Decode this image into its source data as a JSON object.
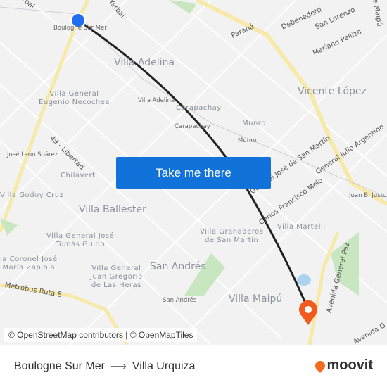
{
  "map": {
    "labels": {
      "boulogne_station": "Boulogne Sur Mer",
      "yerbal": "Yerbal",
      "rbal": "rbal",
      "villa_adelina": "Villa Adelina",
      "villa_adelina_st": "Villa Adelina",
      "necochea": "Villa General\nEugenio Necochea",
      "libertad": "49 - Libertad",
      "jose_leon": "José León Suárez",
      "chilavert": "Chilavert",
      "godoy": "Villa Godoy Cruz",
      "ballester": "Villa Ballester",
      "guido": "Villa General José\nTomás Guido",
      "zapiola": "la Coronel José\nMaría Zapiola",
      "metrobus": "Metrobus Ruta 8",
      "heras": "Villa General\nJuan Gregorio\nde Las Heras",
      "san_andres": "San Andrés",
      "san_andres_st": "San Andrés",
      "villa_maipu": "Villa Maipú",
      "granaderos": "Villa Granaderos\nde San Martín",
      "martelli": "Villa Martelli",
      "vicente_lopez": "Vicente López",
      "carapachay": "Carapachay",
      "carapachay_st": "Carapachay",
      "munro": "Munro",
      "munro_st": "Munro",
      "parana": "Paraná",
      "debenedetti": "Debenedetti",
      "san_lorenzo": "San Lorenzo",
      "pelliza": "Mariano Pelliza",
      "maipu": "de Maipú",
      "san_martin": "General José de San Martín",
      "julio": "General Julio Argentino",
      "melo": "Carlos Francisco Melo",
      "juan_justo": "Juan B. Justo",
      "gral_paz": "Avenida General Paz",
      "avenida": "Avenida G"
    },
    "origin_color": "#1f6ff0",
    "destination_color": "#f25a1f",
    "route_color": "#222222"
  },
  "cta": {
    "label": "Take me there"
  },
  "attribution": "© OpenStreetMap contributors | © OpenMapTiles",
  "footer": {
    "from": "Boulogne Sur Mer",
    "to": "Villa Urquiza",
    "brand": "moovit"
  }
}
